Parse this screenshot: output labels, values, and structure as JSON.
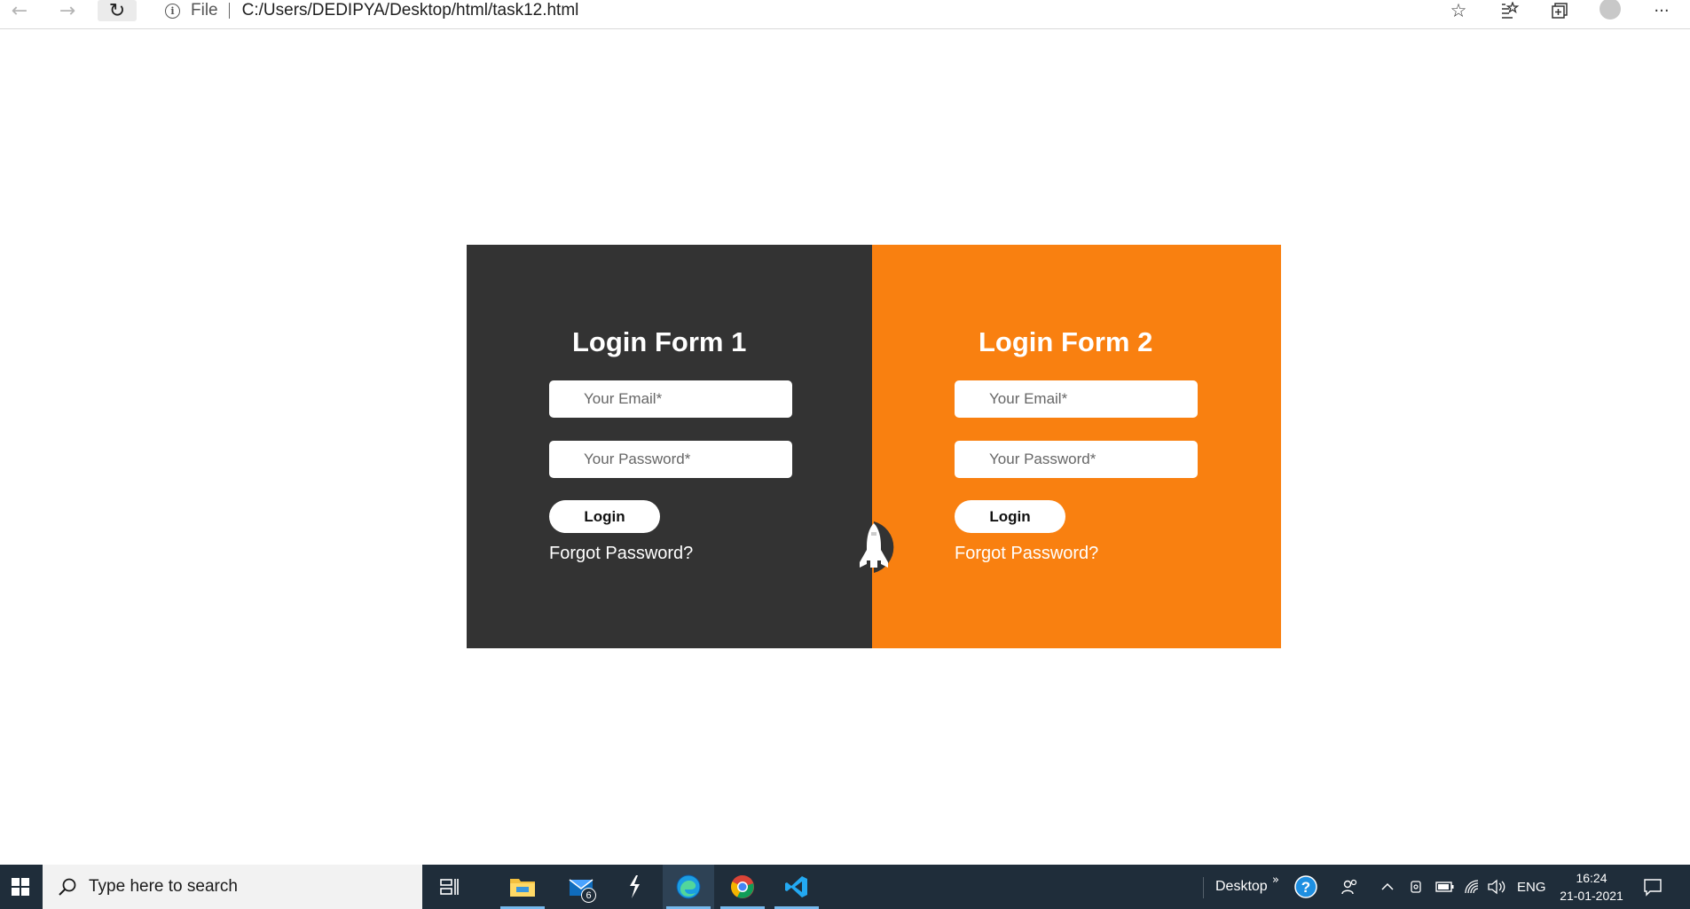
{
  "browser": {
    "address_scheme": "File",
    "address_url": "C:/Users/DEDIPYA/Desktop/html/task12.html"
  },
  "forms": [
    {
      "title": "Login Form 1",
      "email_placeholder": "Your Email*",
      "password_placeholder": "Your Password*",
      "login_label": "Login",
      "forgot_label": "Forgot Password?",
      "background": "#333333"
    },
    {
      "title": "Login Form 2",
      "email_placeholder": "Your Email*",
      "password_placeholder": "Your Password*",
      "login_label": "Login",
      "forgot_label": "Forgot Password?",
      "background": "#f98010"
    }
  ],
  "taskbar": {
    "search_placeholder": "Type here to search",
    "mail_badge": "6",
    "desktop_label": "Desktop",
    "language": "ENG",
    "time": "16:24",
    "date": "21-01-2021",
    "apps": [
      "task-view-icon",
      "file-explorer-icon",
      "mail-icon",
      "stylus-icon",
      "edge-icon",
      "chrome-icon",
      "vscode-icon"
    ]
  }
}
